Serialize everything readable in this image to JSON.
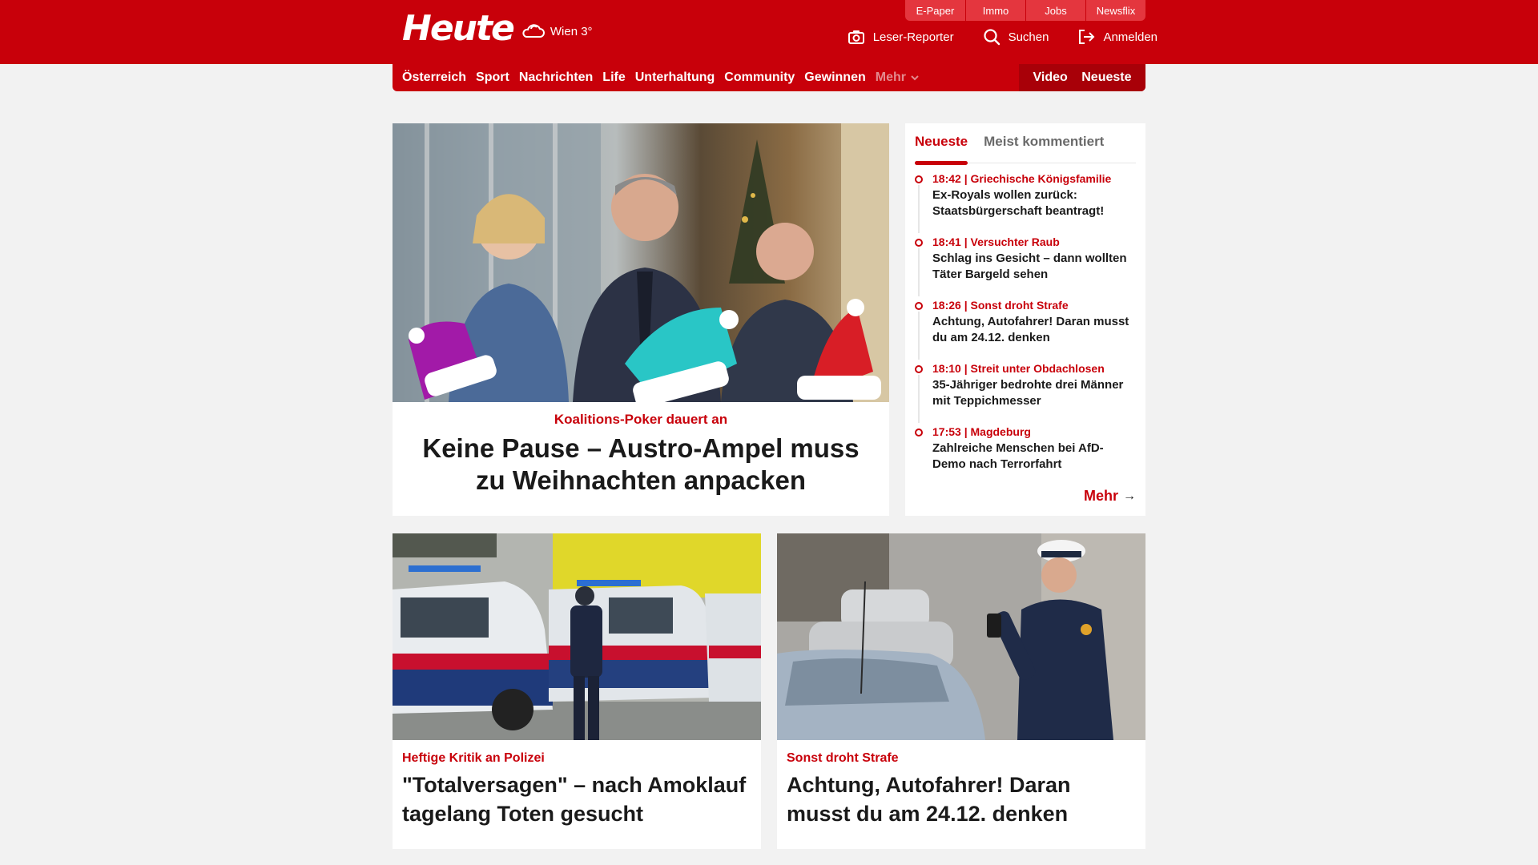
{
  "header": {
    "logo": "Heute",
    "weather": "Wien 3°",
    "top_links": [
      "E-Paper",
      "Immo",
      "Jobs",
      "Newsflix"
    ],
    "actions": {
      "reporter": "Leser-Reporter",
      "search": "Suchen",
      "login": "Anmelden"
    }
  },
  "nav": {
    "items": [
      "Österreich",
      "Sport",
      "Nachrichten",
      "Life",
      "Unterhaltung",
      "Community",
      "Gewinnen"
    ],
    "more": "Mehr",
    "video": "Video",
    "latest": "Neueste"
  },
  "hero": {
    "kicker": "Koalitions-Poker dauert an",
    "title": "Keine Pause – Austro-Ampel muss zu Weihnachten anpacken"
  },
  "sidebar": {
    "tab_active": "Neueste",
    "tab_inactive": "Meist kommentiert",
    "items": [
      {
        "meta": "18:42 | Griechische Königsfamilie",
        "title": "Ex-Royals wollen zurück: Staatsbürgerschaft beantragt!"
      },
      {
        "meta": "18:41 | Versuchter Raub",
        "title": "Schlag ins Gesicht – dann wollten Täter Bargeld sehen"
      },
      {
        "meta": "18:26 | Sonst droht Strafe",
        "title": "Achtung, Autofahrer! Daran musst du am 24.12. denken"
      },
      {
        "meta": "18:10 | Streit unter Obdachlosen",
        "title": "35-Jähriger bedrohte drei Männer mit Teppichmesser"
      },
      {
        "meta": "17:53 | Magdeburg",
        "title": "Zahlreiche Menschen bei AfD-Demo nach Terrorfahrt"
      }
    ],
    "more": "Mehr"
  },
  "cards": [
    {
      "kicker": "Heftige Kritik an Polizei",
      "title": "\"Totalversagen\" – nach Amoklauf tagelang Toten gesucht"
    },
    {
      "kicker": "Sonst droht Strafe",
      "title": "Achtung, Autofahrer! Daran musst du am 24.12. denken"
    }
  ],
  "colors": {
    "brand": "#c8000a",
    "background": "#f2f2f2"
  }
}
